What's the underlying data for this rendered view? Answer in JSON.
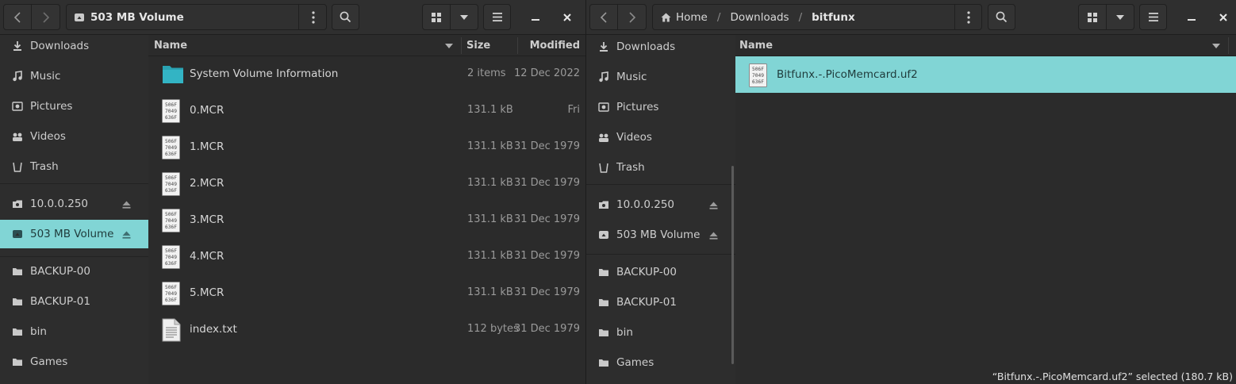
{
  "left_window": {
    "title": "503 MB Volume",
    "sidebar": {
      "places": [
        {
          "label": "Downloads",
          "icon": "download-icon"
        },
        {
          "label": "Music",
          "icon": "music-icon"
        },
        {
          "label": "Pictures",
          "icon": "pictures-icon"
        },
        {
          "label": "Videos",
          "icon": "videos-icon"
        },
        {
          "label": "Trash",
          "icon": "trash-icon"
        }
      ],
      "devices": [
        {
          "label": "10.0.0.250",
          "icon": "network-drive-icon"
        },
        {
          "label": "503 MB Volume",
          "icon": "drive-icon"
        }
      ],
      "bookmarks": [
        {
          "label": "BACKUP-00",
          "icon": "folder-icon"
        },
        {
          "label": "BACKUP-01",
          "icon": "folder-icon"
        },
        {
          "label": "bin",
          "icon": "folder-icon"
        },
        {
          "label": "Games",
          "icon": "folder-icon"
        }
      ]
    },
    "columns": {
      "name": "Name",
      "size": "Size",
      "modified": "Modified"
    },
    "files": [
      {
        "name": "System Volume Information",
        "size": "2 items",
        "modified": "12 Dec 2022",
        "icon": "folder-icon"
      },
      {
        "name": "0.MCR",
        "size": "131.1 kB",
        "modified": "Fri",
        "icon": "binary-file-icon"
      },
      {
        "name": "1.MCR",
        "size": "131.1 kB",
        "modified": "31 Dec 1979",
        "icon": "binary-file-icon"
      },
      {
        "name": "2.MCR",
        "size": "131.1 kB",
        "modified": "31 Dec 1979",
        "icon": "binary-file-icon"
      },
      {
        "name": "3.MCR",
        "size": "131.1 kB",
        "modified": "31 Dec 1979",
        "icon": "binary-file-icon"
      },
      {
        "name": "4.MCR",
        "size": "131.1 kB",
        "modified": "31 Dec 1979",
        "icon": "binary-file-icon"
      },
      {
        "name": "5.MCR",
        "size": "131.1 kB",
        "modified": "31 Dec 1979",
        "icon": "binary-file-icon"
      },
      {
        "name": "index.txt",
        "size": "112 bytes",
        "modified": "31 Dec 1979",
        "icon": "text-file-icon"
      }
    ]
  },
  "right_window": {
    "breadcrumb": [
      "Home",
      "Downloads",
      "bitfunx"
    ],
    "sidebar": {
      "places": [
        {
          "label": "Downloads",
          "icon": "download-icon"
        },
        {
          "label": "Music",
          "icon": "music-icon"
        },
        {
          "label": "Pictures",
          "icon": "pictures-icon"
        },
        {
          "label": "Videos",
          "icon": "videos-icon"
        },
        {
          "label": "Trash",
          "icon": "trash-icon"
        }
      ],
      "devices": [
        {
          "label": "10.0.0.250",
          "icon": "network-drive-icon"
        },
        {
          "label": "503 MB Volume",
          "icon": "drive-icon"
        }
      ],
      "bookmarks": [
        {
          "label": "BACKUP-00",
          "icon": "folder-icon"
        },
        {
          "label": "BACKUP-01",
          "icon": "folder-icon"
        },
        {
          "label": "bin",
          "icon": "folder-icon"
        },
        {
          "label": "Games",
          "icon": "folder-icon"
        }
      ]
    },
    "columns": {
      "name": "Name"
    },
    "files": [
      {
        "name": "Bitfunx.-.PicoMemcard.uf2",
        "icon": "binary-file-icon",
        "selected": true
      }
    ],
    "status": "“Bitfunx.-.PicoMemcard.uf2” selected  (180.7 kB)"
  },
  "binary_icon_lines": [
    "506F",
    "7049",
    "636F"
  ],
  "colors": {
    "accent": "#81d5d5",
    "folder": "#2aa3b3",
    "background": "#2b2b2b"
  }
}
